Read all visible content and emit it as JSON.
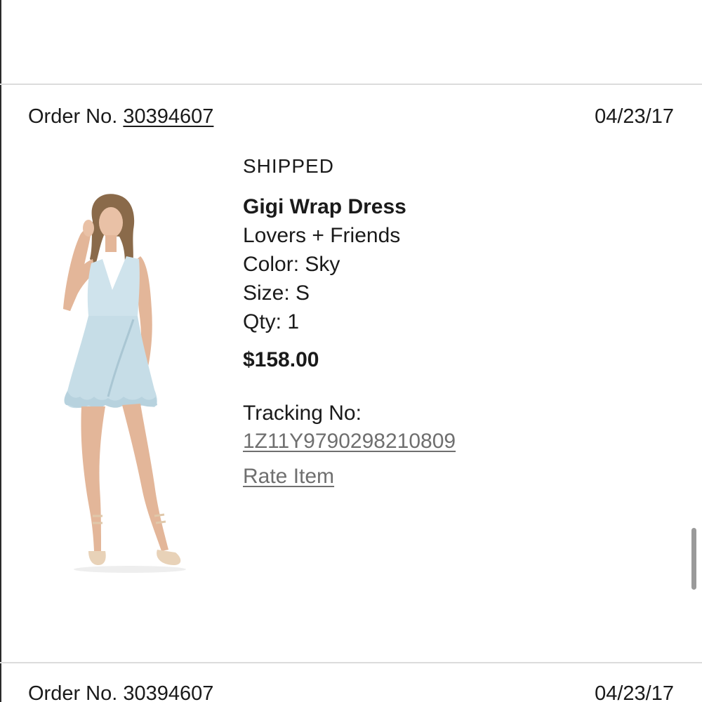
{
  "orders": [
    {
      "order_label": "Order No.",
      "order_number": "30394607",
      "date": "04/23/17",
      "status": "SHIPPED",
      "item": {
        "name": "Gigi Wrap Dress",
        "brand": "Lovers + Friends",
        "color": "Color: Sky",
        "size": "Size: S",
        "qty": "Qty: 1",
        "price": "$158.00",
        "image_icon": "product-photo-dress",
        "dress_color": "#cfe3ec"
      },
      "tracking_label": "Tracking No:",
      "tracking_number": "1Z11Y9790298210809",
      "rate_label": "Rate Item"
    },
    {
      "order_label": "Order No.",
      "order_number": "30394607",
      "date": "04/23/17"
    }
  ],
  "colors": {
    "divider": "#dcdcdc",
    "link_gray": "#6f6f6f",
    "text": "#1a1a1a"
  }
}
